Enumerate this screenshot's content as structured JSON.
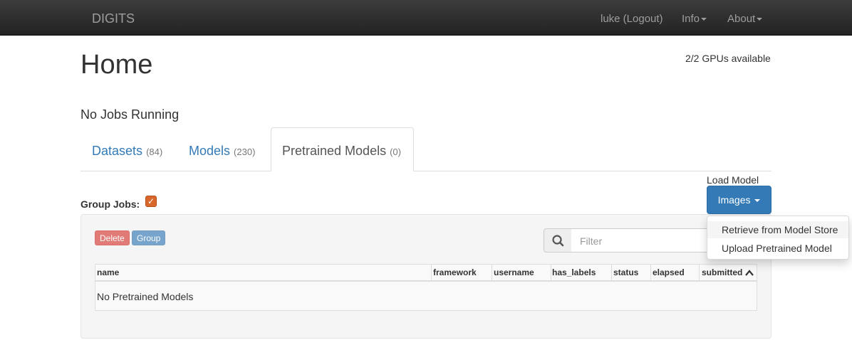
{
  "navbar": {
    "brand": "DIGITS",
    "user_link": "luke (Logout)",
    "info_label": "Info",
    "about_label": "About"
  },
  "header": {
    "title": "Home",
    "gpus": "2/2 GPUs available",
    "jobs_status": "No Jobs Running"
  },
  "tabs": [
    {
      "label": "Datasets",
      "count": "(84)"
    },
    {
      "label": "Models",
      "count": "(230)"
    },
    {
      "label": "Pretrained Models",
      "count": "(0)"
    }
  ],
  "load_model": {
    "label": "Load Model",
    "button_label": "Images",
    "menu_items": [
      "Retrieve from Model Store",
      "Upload Pretrained Model"
    ]
  },
  "group_jobs": {
    "label": "Group Jobs:",
    "checked": true
  },
  "toolbar": {
    "delete_label": "Delete",
    "group_label": "Group",
    "filter_placeholder": "Filter"
  },
  "table": {
    "columns": [
      "name",
      "framework",
      "username",
      "has_labels",
      "status",
      "elapsed",
      "submitted"
    ],
    "empty_message": "No Pretrained Models"
  },
  "colors": {
    "primary": "#337ab7",
    "danger": "#d9534f",
    "checkbox": "#d9662a",
    "navbar": "#222222"
  }
}
